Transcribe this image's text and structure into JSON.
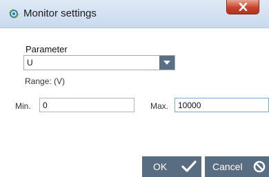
{
  "window": {
    "title": "Monitor settings"
  },
  "form": {
    "parameter_label": "Parameter",
    "parameter_value": "U",
    "range_label": "Range: (V)",
    "min_label": "Min.",
    "min_value": "0",
    "max_label": "Max.",
    "max_value": "10000"
  },
  "buttons": {
    "ok_label": "OK",
    "cancel_label": "Cancel"
  },
  "icons": {
    "app": "monitor-settings-icon",
    "close": "close-icon",
    "dropdown": "chevron-down-icon",
    "ok": "checkmark-icon",
    "cancel": "prohibited-icon"
  },
  "colors": {
    "button_bg": "#596d82",
    "close_bg": "#c7432a",
    "input_focus_border": "#7aa7d6"
  }
}
